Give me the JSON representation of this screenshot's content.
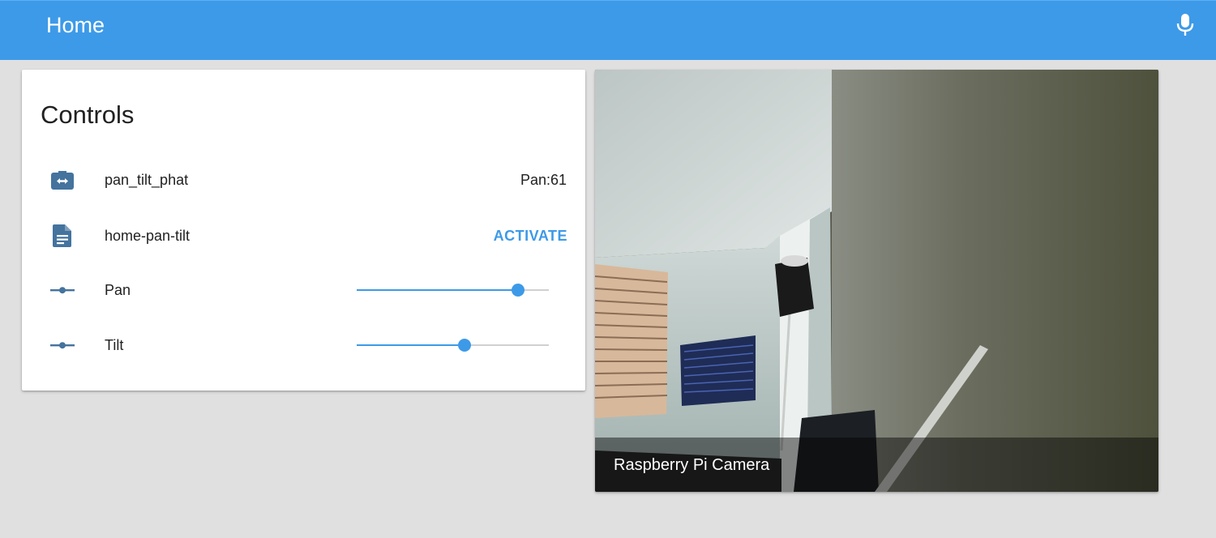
{
  "toolbar": {
    "title": "Home",
    "mic_icon": "microphone-icon",
    "background_color": "#3d9ae8"
  },
  "controls": {
    "title": "Controls",
    "rows": [
      {
        "icon": "pan-tilt-device-icon",
        "label": "pan_tilt_phat",
        "value": "Pan:61"
      },
      {
        "icon": "script-file-icon",
        "label": "home-pan-tilt",
        "action": "ACTIVATE"
      },
      {
        "icon": "slider-icon",
        "label": "Pan",
        "slider_fraction": 0.84
      },
      {
        "icon": "slider-icon",
        "label": "Tilt",
        "slider_fraction": 0.56
      }
    ],
    "accent_color": "#3d9ae8",
    "icon_color": "#44739e"
  },
  "camera": {
    "caption": "Raspberry Pi Camera"
  }
}
